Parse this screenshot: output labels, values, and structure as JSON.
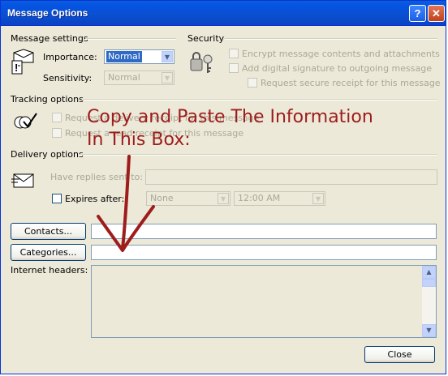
{
  "window": {
    "title": "Message Options"
  },
  "titlebar_buttons": {
    "help": "?",
    "close": "✕"
  },
  "message_settings": {
    "header": "Message settings",
    "importance_label": "Importance:",
    "importance_value": "Normal",
    "sensitivity_label": "Sensitivity:",
    "sensitivity_value": "Normal"
  },
  "security": {
    "header": "Security",
    "encrypt": "Encrypt message contents and attachments",
    "signature": "Add digital signature to outgoing message",
    "secure_receipt": "Request secure receipt for this message"
  },
  "tracking": {
    "header": "Tracking options",
    "delivery_receipt": "Request a delivery receipt for this message",
    "read_receipt": "Request a read receipt for this message"
  },
  "delivery": {
    "header": "Delivery options",
    "replies_label": "Have replies sent to:",
    "expires_label": "Expires after:",
    "expires_date": "None",
    "expires_time": "12:00 AM"
  },
  "buttons": {
    "contacts": "Contacts...",
    "categories": "Categories...",
    "close": "Close"
  },
  "internet_headers_label": "Internet headers:",
  "annotation": {
    "line1": "Copy and Paste The Information",
    "line2": "In This Box:"
  },
  "colors": {
    "titlebar": "#0554e3",
    "annotation": "#9e1c1c",
    "selection": "#316ac5"
  }
}
